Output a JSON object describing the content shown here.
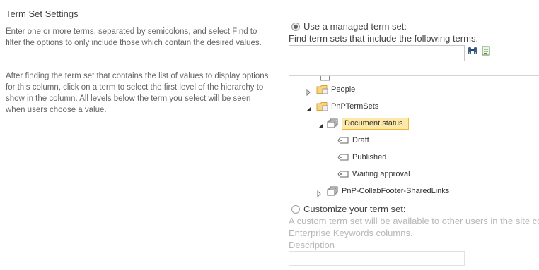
{
  "section": {
    "title": "Term Set Settings",
    "paragraph1": "Enter one or more terms, separated by semicolons, and select Find to filter the options to only include those which contain the desired values.",
    "paragraph2": "After finding the term set that contains the list of values to display options for this column, click on a term to select the first level of the hierarchy to show in the column. All levels below the term you select will be seen when users choose a value."
  },
  "managed": {
    "radio_label": "Use a managed term set:",
    "find_label": "Find term sets that include the following terms.",
    "find_value": "",
    "find_icon": "binoculars-icon",
    "browse_icon": "browse-terms-icon"
  },
  "tree": {
    "nodes": [
      {
        "label": "People",
        "icon": "folder-icon",
        "expanded": false
      },
      {
        "label": "PnPTermSets",
        "icon": "folder-icon",
        "expanded": true
      },
      {
        "label": "Document status",
        "icon": "term-set-icon",
        "expanded": true,
        "selected": true
      },
      {
        "label": "Draft",
        "icon": "term-icon"
      },
      {
        "label": "Published",
        "icon": "term-icon"
      },
      {
        "label": "Waiting approval",
        "icon": "term-icon"
      },
      {
        "label": "PnP-CollabFooter-SharedLinks",
        "icon": "term-set-icon",
        "expanded": false
      }
    ]
  },
  "custom": {
    "radio_label": "Customize your term set:",
    "line1": "A custom term set will be available to other users in the site co",
    "line2": "Enterprise Keywords columns.",
    "description_label": "Description",
    "description_value": ""
  }
}
